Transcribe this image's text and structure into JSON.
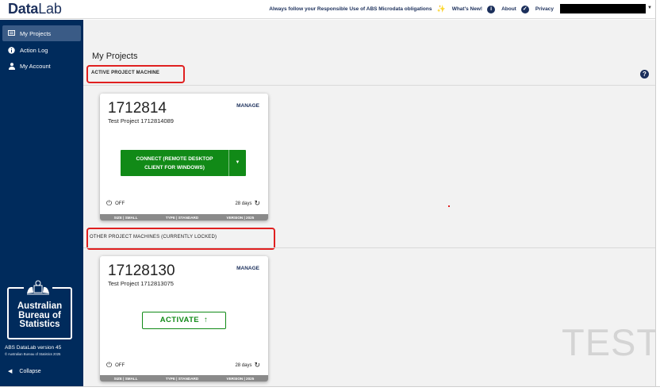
{
  "app": {
    "logo_bold": "Data",
    "logo_light": "Lab"
  },
  "topnav": {
    "responsible_use": "Always follow your Responsible Use of ABS Microdata obligations",
    "whats_new": "What's New!",
    "about": "About",
    "privacy": "Privacy",
    "icons": [
      "sparkle-icon",
      "info-icon",
      "shield-check-icon"
    ]
  },
  "sidebar": {
    "items": [
      {
        "label": "My Projects",
        "icon": "projects-icon",
        "active": true
      },
      {
        "label": "Action Log",
        "icon": "info-icon",
        "active": false
      },
      {
        "label": "My Account",
        "icon": "user-icon",
        "active": false
      }
    ],
    "logo_lines": [
      "Australian",
      "Bureau of",
      "Statistics"
    ],
    "version": "ABS DataLab version 45",
    "copyright": "© Australian Bureau of Statistics 2025",
    "collapse": "Collapse"
  },
  "main": {
    "title": "My Projects",
    "active_section": "ACTIVE PROJECT MACHINE",
    "other_section": "OTHER PROJECT MACHINES (CURRENTLY LOCKED)",
    "watermark": "TEST",
    "active_card": {
      "number": "1712814",
      "description": "Test Project 1712814089",
      "manage": "MANAGE",
      "connect_line1": "CONNECT (REMOTE DESKTOP",
      "connect_line2": "CLIENT FOR WINDOWS)",
      "power_status": "OFF",
      "days": "28 days",
      "footer": {
        "size": "SIZE | SMALL",
        "type": "TYPE | STANDARD",
        "version": "VERSION | 2025"
      }
    },
    "locked_card": {
      "number": "17128130",
      "description": "Test Project 1712813075",
      "manage": "MANAGE",
      "activate": "ACTIVATE",
      "power_status": "OFF",
      "days": "28 days",
      "footer": {
        "size": "SIZE | SMALL",
        "type": "TYPE | STANDARD",
        "version": "VERSION | 2025"
      }
    }
  },
  "colors": {
    "navy": "#002b5c",
    "green": "#118a17",
    "highlight": "#e02020"
  }
}
